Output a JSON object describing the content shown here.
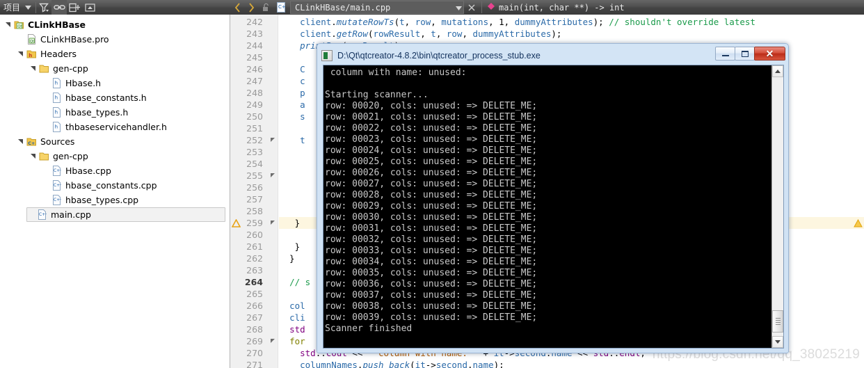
{
  "project_pane": {
    "title": "项目",
    "toolbar": [
      {
        "name": "filter-icon",
        "label": "Filter"
      },
      {
        "name": "link-icon",
        "label": "Synchronize with editor"
      },
      {
        "name": "split-add-icon",
        "label": "Add split"
      },
      {
        "name": "minimize-icon",
        "label": "Hide sidebar"
      }
    ],
    "tree": [
      {
        "label": "CLinkHBase",
        "depth": 0,
        "icon": "qt-project-icon",
        "twisty": "open",
        "bold": true,
        "selected": false
      },
      {
        "label": "CLinkHBase.pro",
        "depth": 1,
        "icon": "qt-pro-file-icon",
        "twisty": "none",
        "bold": false,
        "selected": false
      },
      {
        "label": "Headers",
        "depth": 1,
        "icon": "headers-folder-icon",
        "twisty": "open",
        "bold": false,
        "selected": false
      },
      {
        "label": "gen-cpp",
        "depth": 2,
        "icon": "folder-icon",
        "twisty": "open",
        "bold": false,
        "selected": false
      },
      {
        "label": "Hbase.h",
        "depth": 3,
        "icon": "h-file-icon",
        "twisty": "none",
        "bold": false,
        "selected": false
      },
      {
        "label": "hbase_constants.h",
        "depth": 3,
        "icon": "h-file-icon",
        "twisty": "none",
        "bold": false,
        "selected": false
      },
      {
        "label": "hbase_types.h",
        "depth": 3,
        "icon": "h-file-icon",
        "twisty": "none",
        "bold": false,
        "selected": false
      },
      {
        "label": "thbaseservicehandler.h",
        "depth": 3,
        "icon": "h-file-icon",
        "twisty": "none",
        "bold": false,
        "selected": false
      },
      {
        "label": "Sources",
        "depth": 1,
        "icon": "sources-folder-icon",
        "twisty": "open",
        "bold": false,
        "selected": false
      },
      {
        "label": "gen-cpp",
        "depth": 2,
        "icon": "folder-icon",
        "twisty": "open",
        "bold": false,
        "selected": false
      },
      {
        "label": "Hbase.cpp",
        "depth": 3,
        "icon": "cpp-file-icon",
        "twisty": "none",
        "bold": false,
        "selected": false
      },
      {
        "label": "hbase_constants.cpp",
        "depth": 3,
        "icon": "cpp-file-icon",
        "twisty": "none",
        "bold": false,
        "selected": false
      },
      {
        "label": "hbase_types.cpp",
        "depth": 3,
        "icon": "cpp-file-icon",
        "twisty": "none",
        "bold": false,
        "selected": false
      },
      {
        "label": "main.cpp",
        "depth": 2,
        "icon": "cpp-file-icon",
        "twisty": "none",
        "bold": false,
        "selected": true
      }
    ]
  },
  "editor_toolbar": {
    "back_label": "‹",
    "forward_label": "›",
    "lock_icon": "unlocked-icon",
    "file_icon": "cpp-file-icon",
    "file_label": "CLinkHBase/main.cpp",
    "dropdown_icon": "chevron-down-icon",
    "close_label": "×",
    "symbol_marker": "diamond-marker-icon",
    "symbol_label": "main(int, char **) -> int"
  },
  "editor": {
    "first_line": 242,
    "current_line": 264,
    "lines": [
      {
        "n": 242,
        "fold": false,
        "warn": false,
        "text": "    client.mutateRowTs(t, row, mutations, 1, dummyAttributes); // shouldn't override latest"
      },
      {
        "n": 243,
        "fold": false,
        "warn": false,
        "text": "    client.getRow(rowResult, t, row, dummyAttributes);"
      },
      {
        "n": 244,
        "fold": false,
        "warn": false,
        "text": "    printRow(rowResult);"
      },
      {
        "n": 245,
        "fold": false,
        "warn": false,
        "text": ""
      },
      {
        "n": 246,
        "fold": false,
        "warn": false,
        "text": "    C"
      },
      {
        "n": 247,
        "fold": false,
        "warn": false,
        "text": "    c"
      },
      {
        "n": 248,
        "fold": false,
        "warn": false,
        "text": "    p"
      },
      {
        "n": 249,
        "fold": false,
        "warn": false,
        "text": "    a"
      },
      {
        "n": 250,
        "fold": false,
        "warn": false,
        "text": "    s"
      },
      {
        "n": 251,
        "fold": false,
        "warn": false,
        "text": ""
      },
      {
        "n": 252,
        "fold": true,
        "warn": false,
        "text": "    t"
      },
      {
        "n": 253,
        "fold": false,
        "warn": false,
        "text": ""
      },
      {
        "n": 254,
        "fold": false,
        "warn": false,
        "text": ""
      },
      {
        "n": 255,
        "fold": true,
        "warn": false,
        "text": ""
      },
      {
        "n": 256,
        "fold": false,
        "warn": false,
        "text": ""
      },
      {
        "n": 257,
        "fold": false,
        "warn": false,
        "text": ""
      },
      {
        "n": 258,
        "fold": false,
        "warn": false,
        "text": ""
      },
      {
        "n": 259,
        "fold": true,
        "warn": true,
        "text": "   }"
      },
      {
        "n": 260,
        "fold": false,
        "warn": false,
        "text": ""
      },
      {
        "n": 261,
        "fold": false,
        "warn": false,
        "text": "   }"
      },
      {
        "n": 262,
        "fold": false,
        "warn": false,
        "text": "  }"
      },
      {
        "n": 263,
        "fold": false,
        "warn": false,
        "text": ""
      },
      {
        "n": 264,
        "fold": false,
        "warn": false,
        "text": "  // s"
      },
      {
        "n": 265,
        "fold": false,
        "warn": false,
        "text": ""
      },
      {
        "n": 266,
        "fold": false,
        "warn": false,
        "text": "  col"
      },
      {
        "n": 267,
        "fold": false,
        "warn": false,
        "text": "  cli"
      },
      {
        "n": 268,
        "fold": false,
        "warn": false,
        "text": "  std"
      },
      {
        "n": 269,
        "fold": true,
        "warn": false,
        "text": "  for"
      },
      {
        "n": 270,
        "fold": false,
        "warn": false,
        "text": "    std::cout << \" column with name: \" + it->second.name << std::endl;"
      },
      {
        "n": 271,
        "fold": false,
        "warn": false,
        "text": "    columnNames.push_back(it->second.name);"
      }
    ]
  },
  "console_window": {
    "title": "D:\\Qt\\qtcreator-4.8.2\\bin\\qtcreator_process_stub.exe",
    "app_icon": "console-app-icon",
    "buttons": {
      "minimize": "minimize-icon",
      "maximize": "maximize-icon",
      "close": "close-icon"
    },
    "scrollbar": {
      "up_arrow": "scroll-up-arrow-icon",
      "down_arrow": "scroll-down-arrow-icon",
      "thumb": "scrollbar-thumb"
    },
    "output": [
      " column with name: unused:",
      "",
      "Starting scanner...",
      "row: 00020, cols: unused: => DELETE_ME;",
      "row: 00021, cols: unused: => DELETE_ME;",
      "row: 00022, cols: unused: => DELETE_ME;",
      "row: 00023, cols: unused: => DELETE_ME;",
      "row: 00024, cols: unused: => DELETE_ME;",
      "row: 00025, cols: unused: => DELETE_ME;",
      "row: 00026, cols: unused: => DELETE_ME;",
      "row: 00027, cols: unused: => DELETE_ME;",
      "row: 00028, cols: unused: => DELETE_ME;",
      "row: 00029, cols: unused: => DELETE_ME;",
      "row: 00030, cols: unused: => DELETE_ME;",
      "row: 00031, cols: unused: => DELETE_ME;",
      "row: 00032, cols: unused: => DELETE_ME;",
      "row: 00033, cols: unused: => DELETE_ME;",
      "row: 00034, cols: unused: => DELETE_ME;",
      "row: 00035, cols: unused: => DELETE_ME;",
      "row: 00036, cols: unused: => DELETE_ME;",
      "row: 00037, cols: unused: => DELETE_ME;",
      "row: 00038, cols: unused: => DELETE_ME;",
      "row: 00039, cols: unused: => DELETE_ME;",
      "Scanner finished"
    ]
  },
  "watermark": "https://blog.csdn.net/qq_38025219",
  "colors": {
    "toolbar_dark": "#4d4d4d",
    "comment_green": "#1a9a4a",
    "keyword_olive": "#808000",
    "type_purple": "#800080",
    "member_blue": "#2b6aa8",
    "warn_band": "#fdf6e0",
    "warn_amber": "#f2b01e",
    "console_bg": "#000000",
    "console_fg": "#c8c8c8",
    "selection_grey": "#f2f2f2"
  }
}
